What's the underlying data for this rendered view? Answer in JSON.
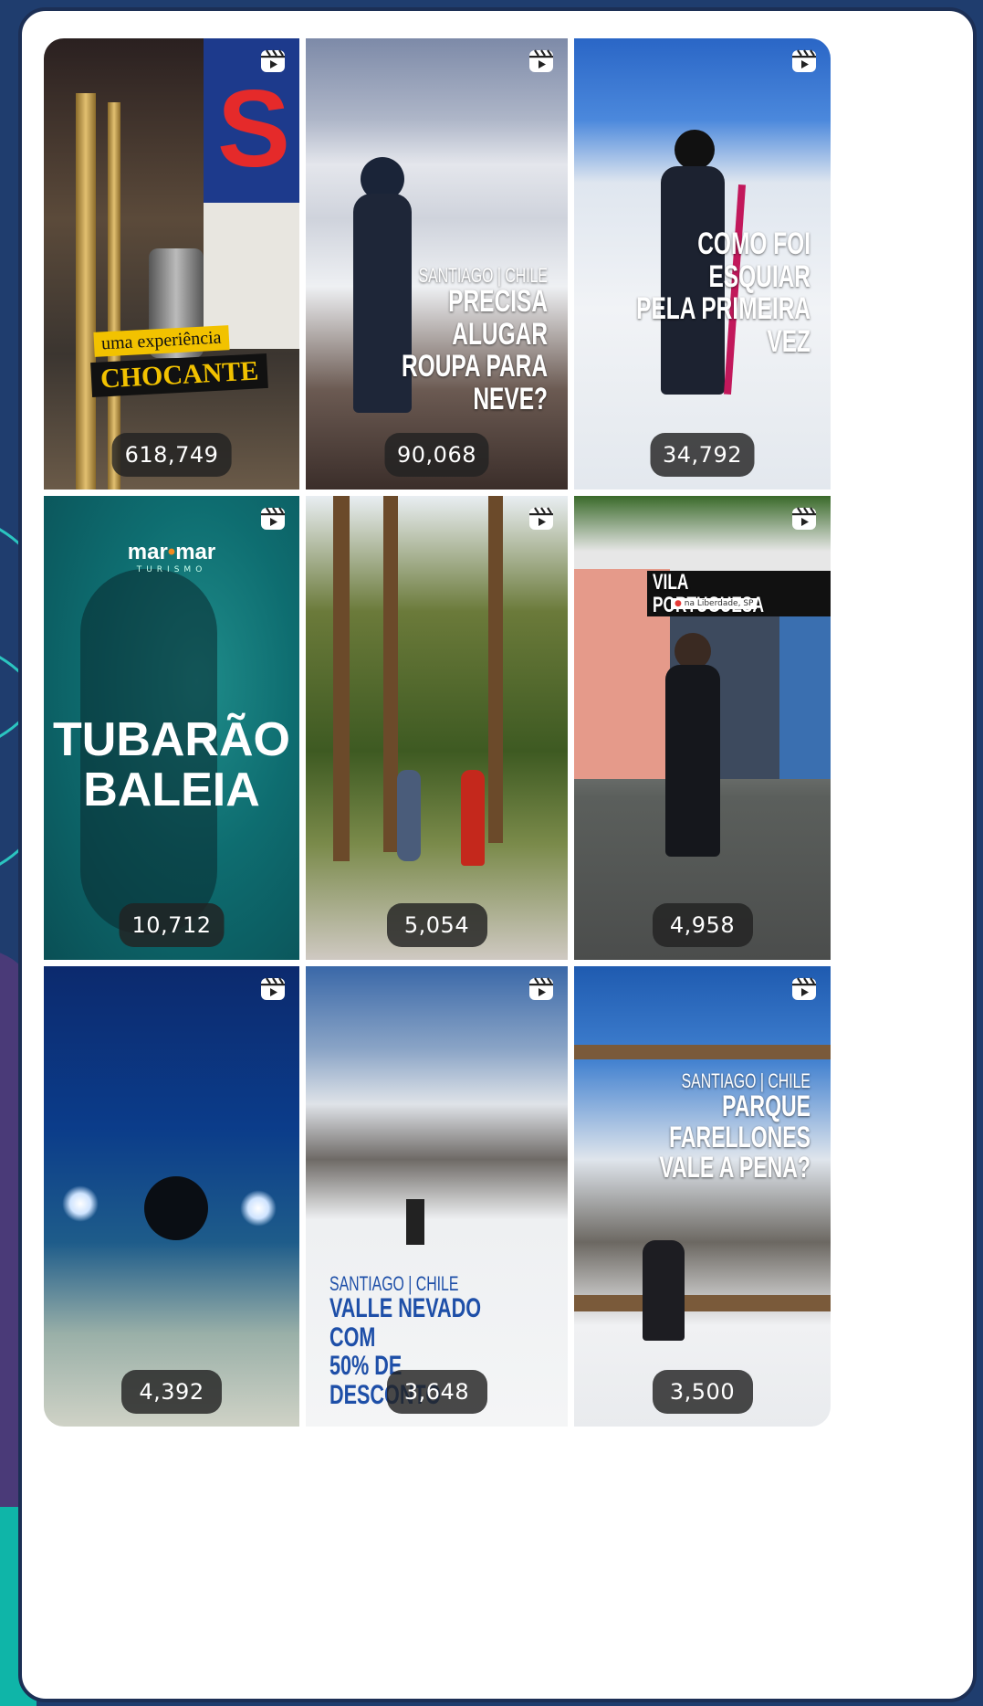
{
  "tiles": [
    {
      "views": "618,749",
      "overlay": {
        "line1": "uma experiência",
        "line2": "CHOCANTE",
        "sign": "S"
      }
    },
    {
      "views": "90,068",
      "overlay": {
        "kicker": "SANTIAGO | CHILE",
        "line1": "PRECISA ALUGAR",
        "line2": "ROUPA PARA NEVE?"
      }
    },
    {
      "views": "34,792",
      "overlay": {
        "line1": "COMO FOI ESQUIAR",
        "line2": "PELA PRIMEIRA VEZ"
      }
    },
    {
      "views": "10,712",
      "overlay": {
        "brand": "mar",
        "brand2": "mar",
        "brand_sub": "TURISMO",
        "line1": "TUBARÃO",
        "line2": "BALEIA"
      }
    },
    {
      "views": "5,054",
      "overlay": {}
    },
    {
      "views": "4,958",
      "overlay": {
        "line1": "VILA PORTUGUESA",
        "location": "na Liberdade, SP"
      }
    },
    {
      "views": "4,392",
      "overlay": {}
    },
    {
      "views": "3,648",
      "overlay": {
        "kicker": "SANTIAGO | CHILE",
        "line1": "VALLE NEVADO COM",
        "line2": "50% DE DESCONTO"
      }
    },
    {
      "views": "3,500",
      "overlay": {
        "kicker": "SANTIAGO | CHILE",
        "line1": "PARQUE FARELLONES",
        "line2": "VALE A PENA?"
      }
    }
  ],
  "icons": {
    "reel": "reels-icon"
  },
  "colors": {
    "frame": "#1c2f55",
    "badge": "#222222",
    "sticker_yellow": "#f2c200"
  }
}
